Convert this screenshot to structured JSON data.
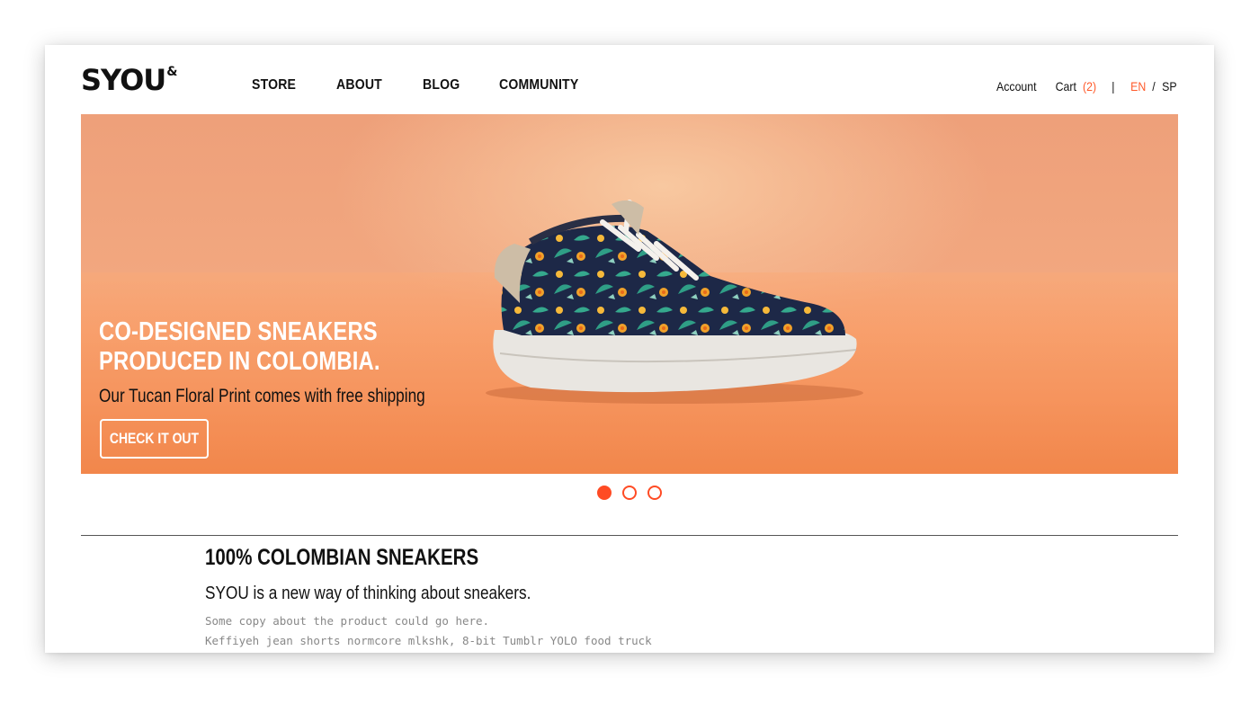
{
  "brand": {
    "name": "SYOU",
    "mark": "&"
  },
  "nav": {
    "items": [
      "STORE",
      "ABOUT",
      "BLOG",
      "COMMUNITY"
    ]
  },
  "utility": {
    "account_label": "Account",
    "cart_label": "Cart",
    "cart_count": "(2)",
    "divider": "|",
    "lang_active": "EN",
    "lang_sep": "/",
    "lang_other": "SP"
  },
  "hero": {
    "title_line1": "CO-DESIGNED SNEAKERS",
    "title_line2": "PRODUCED IN COLOMBIA.",
    "subtitle": "Our Tucan Floral Print comes with free shipping",
    "cta_label": "CHECK IT OUT",
    "image_subject": "floral-sneaker-image"
  },
  "carousel": {
    "slide_count": 3,
    "active_index": 0
  },
  "intro": {
    "title": "100% COLOMBIAN SNEAKERS",
    "lead": "SYOU is a new way of thinking about sneakers.",
    "body_line1": "Some copy about the product could go here.",
    "body_line2": "Keffiyeh jean shorts normcore mlkshk, 8-bit Tumblr YOLO food truck"
  },
  "colors": {
    "accent": "#ff4b24",
    "text": "#111111",
    "hero_orange": "#f59157",
    "muted": "#888888"
  }
}
